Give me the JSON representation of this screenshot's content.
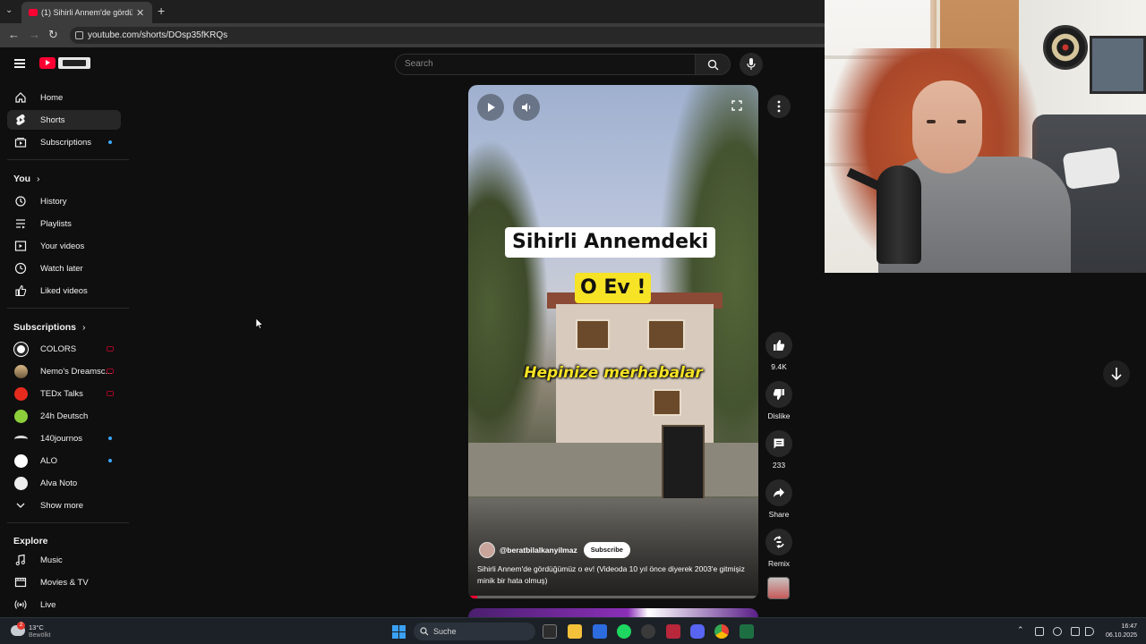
{
  "browser": {
    "tab_title": "(1) Sihirli Annem'de gördüğüm",
    "url": "youtube.com/shorts/DOsp35fKRQs"
  },
  "header": {
    "search_placeholder": "Search"
  },
  "sidebar": {
    "main": [
      {
        "label": "Home",
        "icon": "home-icon"
      },
      {
        "label": "Shorts",
        "icon": "shorts-icon",
        "active": true
      },
      {
        "label": "Subscriptions",
        "icon": "subscriptions-icon"
      }
    ],
    "you_title": "You",
    "you": [
      {
        "label": "History",
        "icon": "history-icon"
      },
      {
        "label": "Playlists",
        "icon": "playlists-icon"
      },
      {
        "label": "Your videos",
        "icon": "your-videos-icon"
      },
      {
        "label": "Watch later",
        "icon": "watch-later-icon"
      },
      {
        "label": "Liked videos",
        "icon": "liked-videos-icon"
      }
    ],
    "subs_title": "Subscriptions",
    "subscriptions": [
      {
        "label": "COLORS",
        "color": "#ffffff"
      },
      {
        "label": "Nemo's Dreamsc...",
        "color": "#b58a5a"
      },
      {
        "label": "TEDx Talks",
        "color": "#e62b1e"
      },
      {
        "label": "24h Deutsch",
        "color": "#8ccf3a"
      },
      {
        "label": "140journos",
        "color": "#dddddd"
      },
      {
        "label": "ALO",
        "color": "#ffffff"
      },
      {
        "label": "Alva Noto",
        "color": "#eeeeee"
      }
    ],
    "show_more": "Show more",
    "explore_title": "Explore",
    "explore": [
      {
        "label": "Music",
        "icon": "music-icon"
      },
      {
        "label": "Movies & TV",
        "icon": "movies-icon"
      },
      {
        "label": "Live",
        "icon": "live-icon"
      }
    ]
  },
  "short": {
    "overlay_title": "Sihirli Annemdeki",
    "overlay_subtitle": "O Ev !",
    "caption": "Hepinize merhabalar",
    "channel": "@beratbilalkanyilmaz",
    "subscribe": "Subscribe",
    "description": "Sihirli Annem'de gördüğümüz o ev! (Videoda 10 yıl önce diyerek 2003'e gitmişiz minik bir hata olmuş)",
    "progress": 0.03
  },
  "actions": {
    "likes": "9.4K",
    "dislike": "Dislike",
    "comments": "233",
    "share": "Share",
    "remix": "Remix"
  },
  "taskbar": {
    "temperature": "13°C",
    "weather_desc": "Bewölkt",
    "weather_badge": "2",
    "search": "Suche",
    "time": "16:47",
    "date": "06.10.2025"
  }
}
